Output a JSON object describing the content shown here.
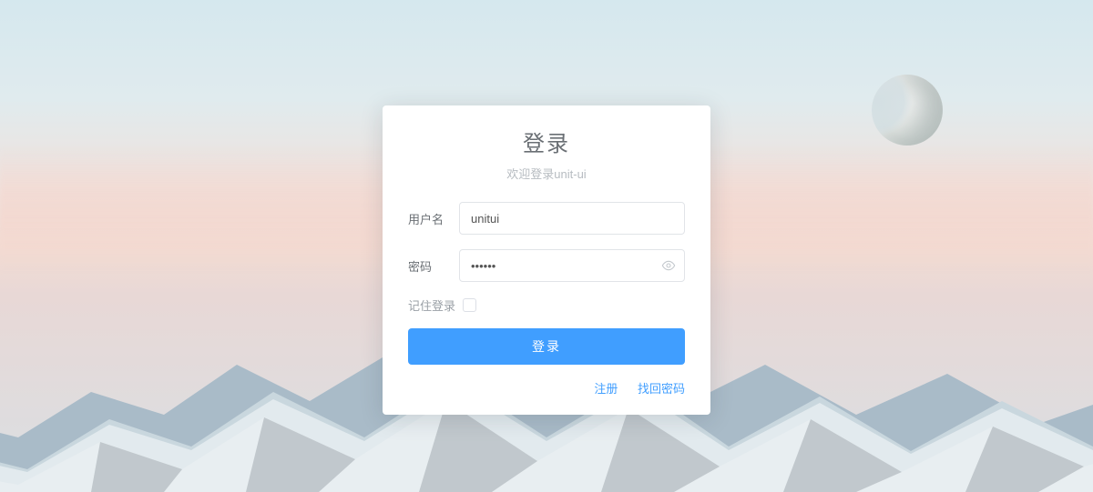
{
  "login": {
    "title": "登录",
    "subtitle": "欢迎登录unit-ui",
    "username_label": "用户名",
    "username_value": "unitui",
    "password_label": "密码",
    "password_value": "••••••",
    "remember_label": "记住登录",
    "remember_checked": false,
    "submit_label": "登录",
    "register_link": "注册",
    "forgot_link": "找回密码"
  },
  "icons": {
    "eye": "eye-icon"
  },
  "colors": {
    "primary": "#409eff"
  }
}
